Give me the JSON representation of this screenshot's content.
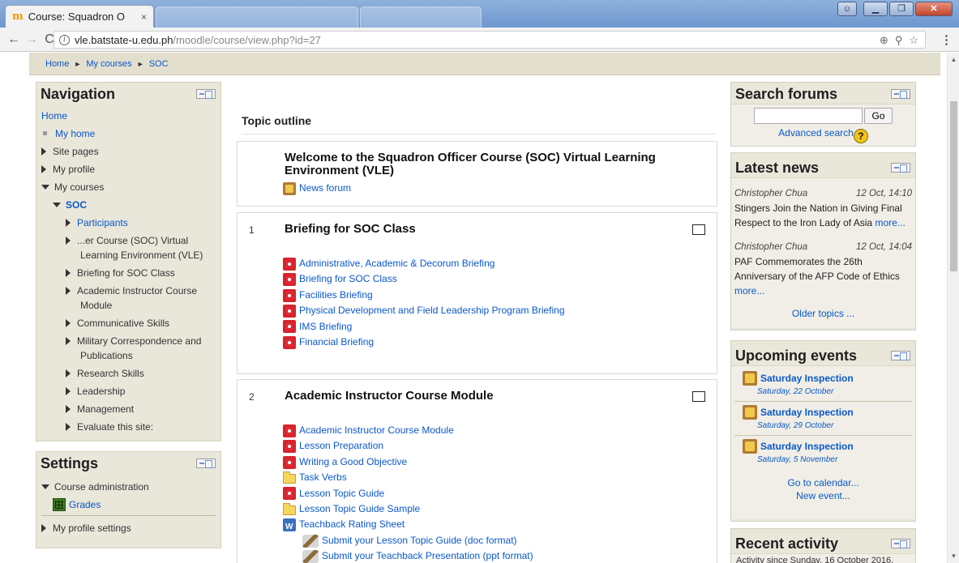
{
  "browser": {
    "tab_title": "Course: Squadron O",
    "tab_close": "×",
    "url_host": "vle.batstate-u.edu.ph",
    "url_path": "/moodle/course/view.php?id=27"
  },
  "breadcrumb": {
    "home": "Home",
    "my_courses": "My courses",
    "course": "SOC",
    "sep": "►"
  },
  "navigation": {
    "title": "Navigation",
    "home": "Home",
    "my_home": "My home",
    "site_pages": "Site pages",
    "my_profile": "My profile",
    "my_courses": "My courses",
    "course": "SOC",
    "items": [
      "Participants",
      "...er Course (SOC) Virtual Learning Environment (VLE)",
      "Briefing for SOC Class",
      "Academic Instructor Course Module",
      "Communicative Skills",
      "Military Correspondence and Publications",
      "Research Skills",
      "Leadership",
      "Management",
      "Evaluate this site:"
    ]
  },
  "settings": {
    "title": "Settings",
    "course_admin": "Course administration",
    "grades": "Grades",
    "profile_settings": "My profile settings"
  },
  "main": {
    "topic_outline": "Topic outline",
    "welcome": {
      "title": "Welcome to the Squadron Officer Course (SOC) Virtual Learning Environment (VLE)",
      "forum": "News forum"
    },
    "section1": {
      "num": "1",
      "title": "Briefing for SOC Class",
      "activities": [
        "Administrative, Academic & Decorum Briefing",
        "Briefing for SOC Class",
        "Facilities Briefing",
        "Physical Development and Field Leadership Program Briefing",
        "IMS Briefing",
        "Financial Briefing"
      ]
    },
    "section2": {
      "num": "2",
      "title": "Academic Instructor Course Module",
      "activities": [
        "Academic Instructor Course Module",
        "Lesson Preparation",
        "Writing a Good Objective",
        "Task Verbs",
        "Lesson Topic Guide",
        "Lesson Topic Guide Sample",
        "Teachback Rating Sheet",
        "Submit your Lesson Topic Guide (doc format)",
        "Submit your Teachback Presentation (ppt format)"
      ]
    }
  },
  "search_forums": {
    "title": "Search forums",
    "go": "Go",
    "advanced": "Advanced search",
    "help": "?"
  },
  "latest_news": {
    "title": "Latest news",
    "items": [
      {
        "author": "Christopher Chua",
        "date": "12 Oct, 14:10",
        "text": "Stingers Join the Nation in Giving Final Respect to the Iron Lady of Asia",
        "more": "more..."
      },
      {
        "author": "Christopher Chua",
        "date": "12 Oct, 14:04",
        "text": "PAF Commemorates the 26th Anniversary of the AFP Code of Ethics",
        "more": "more..."
      }
    ],
    "older": "Older topics ..."
  },
  "upcoming_events": {
    "title": "Upcoming events",
    "events": [
      {
        "title": "Saturday Inspection",
        "date": "Saturday, 22 October"
      },
      {
        "title": "Saturday Inspection",
        "date": "Saturday, 29 October"
      },
      {
        "title": "Saturday Inspection",
        "date": "Saturday, 5 November"
      }
    ],
    "calendar": "Go to calendar...",
    "new_event": "New event..."
  },
  "recent_activity": {
    "title": "Recent activity",
    "since": "Activity since Sunday, 16 October 2016,"
  }
}
